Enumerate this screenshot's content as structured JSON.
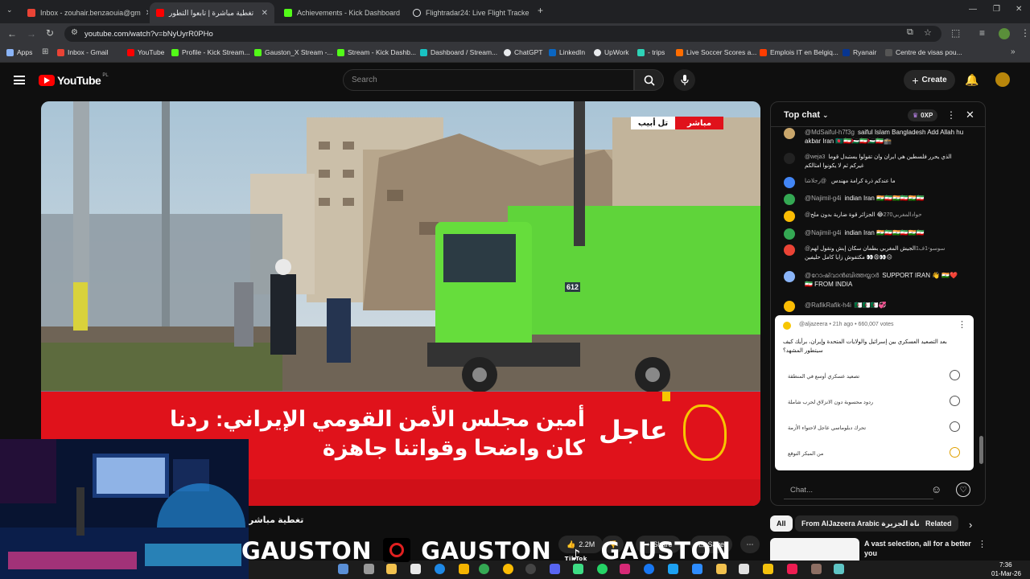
{
  "browser": {
    "tabs": [
      {
        "label": "Inbox - zouhair.benzaouia@gm",
        "color": "#ea4335"
      },
      {
        "label": "تغطية مباشرة | تابعوا التطور",
        "color": "#ff0000"
      },
      {
        "label": "Achievements - Kick Dashboard",
        "color": "#53fc18"
      },
      {
        "label": "Flightradar24: Live Flight Tracke",
        "color": "#e8eaed"
      }
    ],
    "url": "youtube.com/watch?v=bNyUyrR0PHo",
    "bookmarks": [
      {
        "label": "Apps",
        "color": "#8ab4f8"
      },
      {
        "label": "Inbox - Gmail",
        "color": "#ea4335"
      },
      {
        "label": "YouTube",
        "color": "#ff0000"
      },
      {
        "label": "Profile - Kick Stream...",
        "color": "#53fc18"
      },
      {
        "label": "Gauston_X Stream -...",
        "color": "#53fc18"
      },
      {
        "label": "Stream - Kick Dashb...",
        "color": "#53fc18"
      },
      {
        "label": "Dashboard / Stream...",
        "color": "#19c2c2"
      },
      {
        "label": "ChatGPT",
        "color": "#e8eaed"
      },
      {
        "label": "LinkedIn",
        "color": "#0a66c2"
      },
      {
        "label": "UpWork",
        "color": "#e8eaed"
      },
      {
        "label": "- trips",
        "color": "#2ed3b7"
      },
      {
        "label": "Live Soccer Scores a...",
        "color": "#ff6d00"
      },
      {
        "label": "Emplois IT en Belgiq...",
        "color": "#ff3d00"
      },
      {
        "label": "Ryanair",
        "color": "#073590"
      },
      {
        "label": "Centre de visas pou...",
        "color": "#555"
      }
    ]
  },
  "youtube": {
    "logo": "YouTube",
    "region": "PL",
    "search_placeholder": "Search",
    "create_label": "Create"
  },
  "video": {
    "live_badge": "مباشر",
    "location": "تل أبيب",
    "breaking": "عاجل",
    "ticker_line1": "أمين مجلس الأمن القومي الإيراني: ردنا",
    "ticker_line2": "كان واضحا وقواتنا جاهزة",
    "truck_number": "612"
  },
  "chat": {
    "header": "Top chat",
    "points": "0XP",
    "messages": [
      {
        "author": "@MdSaiful-h7f3g",
        "text": "saiful Islam Bangladesh Add Allah hu akbar Iran 🇧🇩🇮🇷🇵🇸🇮🇷🇵🇸🇮🇷🕋",
        "color": "#c9a66b"
      },
      {
        "author": "@weja3",
        "text": "الذي يحرر فلسطين هي ايران وان تقولوا يستبدل قوما غيركم ثم لا يكونوا امثالكم",
        "color": "#222"
      },
      {
        "author": "@رجلاشا",
        "text": "ما عندكم ذرة كرامة مهندس",
        "color": "#4285f4"
      },
      {
        "author": "@Najimil-g4i",
        "text": "indian Iran 🇮🇳🇮🇷🇮🇳🇮🇷🇮🇳🇮🇷",
        "color": "#34a853"
      },
      {
        "author": "@حوادالمغربي270",
        "text": "😂 الجزائر قوة ضاربة بدون ملح",
        "color": "#fbbc04"
      },
      {
        "author": "@Najimil-g4i",
        "text": "indian Iran 🇮🇳🇮🇷🇮🇳🇮🇷🇮🇳🇮🇷",
        "color": "#34a853"
      },
      {
        "author": "@سوسو-1ف1",
        "text": "الجيش المغربي بطمان سكان إبش ونقول لهم مكتفوش زايا كامل حليفين 👀😩👀😑",
        "color": "#ea4335"
      },
      {
        "author": "@റോഷ്‌വാൻബിത്തയ്യാർ",
        "text": "SUPPORT IRAN 👋 🇮🇳❤️🇮🇷 FROM INDIA",
        "color": "#8ab4f8"
      },
      {
        "author": "@RafikRafik-h4i",
        "text": "🇩🇿🇩🇿🇩🇿💞",
        "color": "#fbbc04"
      }
    ],
    "poll": {
      "meta": "@aljazeera • 21h ago • 660,007 votes",
      "question": "بعد التصعيد العسكري بين إسرائيل والولايات المتحدة وإيران، برأيك كيف سيتطور المشهد؟",
      "options": [
        "تصعيد عسكري أوسع في المنطقة",
        "ردود محسوبة دون الانزلاق لحرب شاملة",
        "تحرك دبلوماسي عاجل لاحتواء الأزمة",
        "من المبكر التوقع"
      ]
    },
    "input_placeholder": "Chat..."
  },
  "below": {
    "title_fragment": "تغطية مباشر",
    "likes": "2.2M",
    "share": "Share",
    "save": "Save",
    "chips": [
      "All",
      "From AlJazeera Arabic قناة الجزيرة",
      "Related"
    ],
    "rec_title": "A vast selection, all for a better you"
  },
  "overlay": {
    "brand": "GAUSTON",
    "tiktok": "TikTok"
  },
  "system": {
    "time": "7:36",
    "date": "01-Mar-26"
  }
}
